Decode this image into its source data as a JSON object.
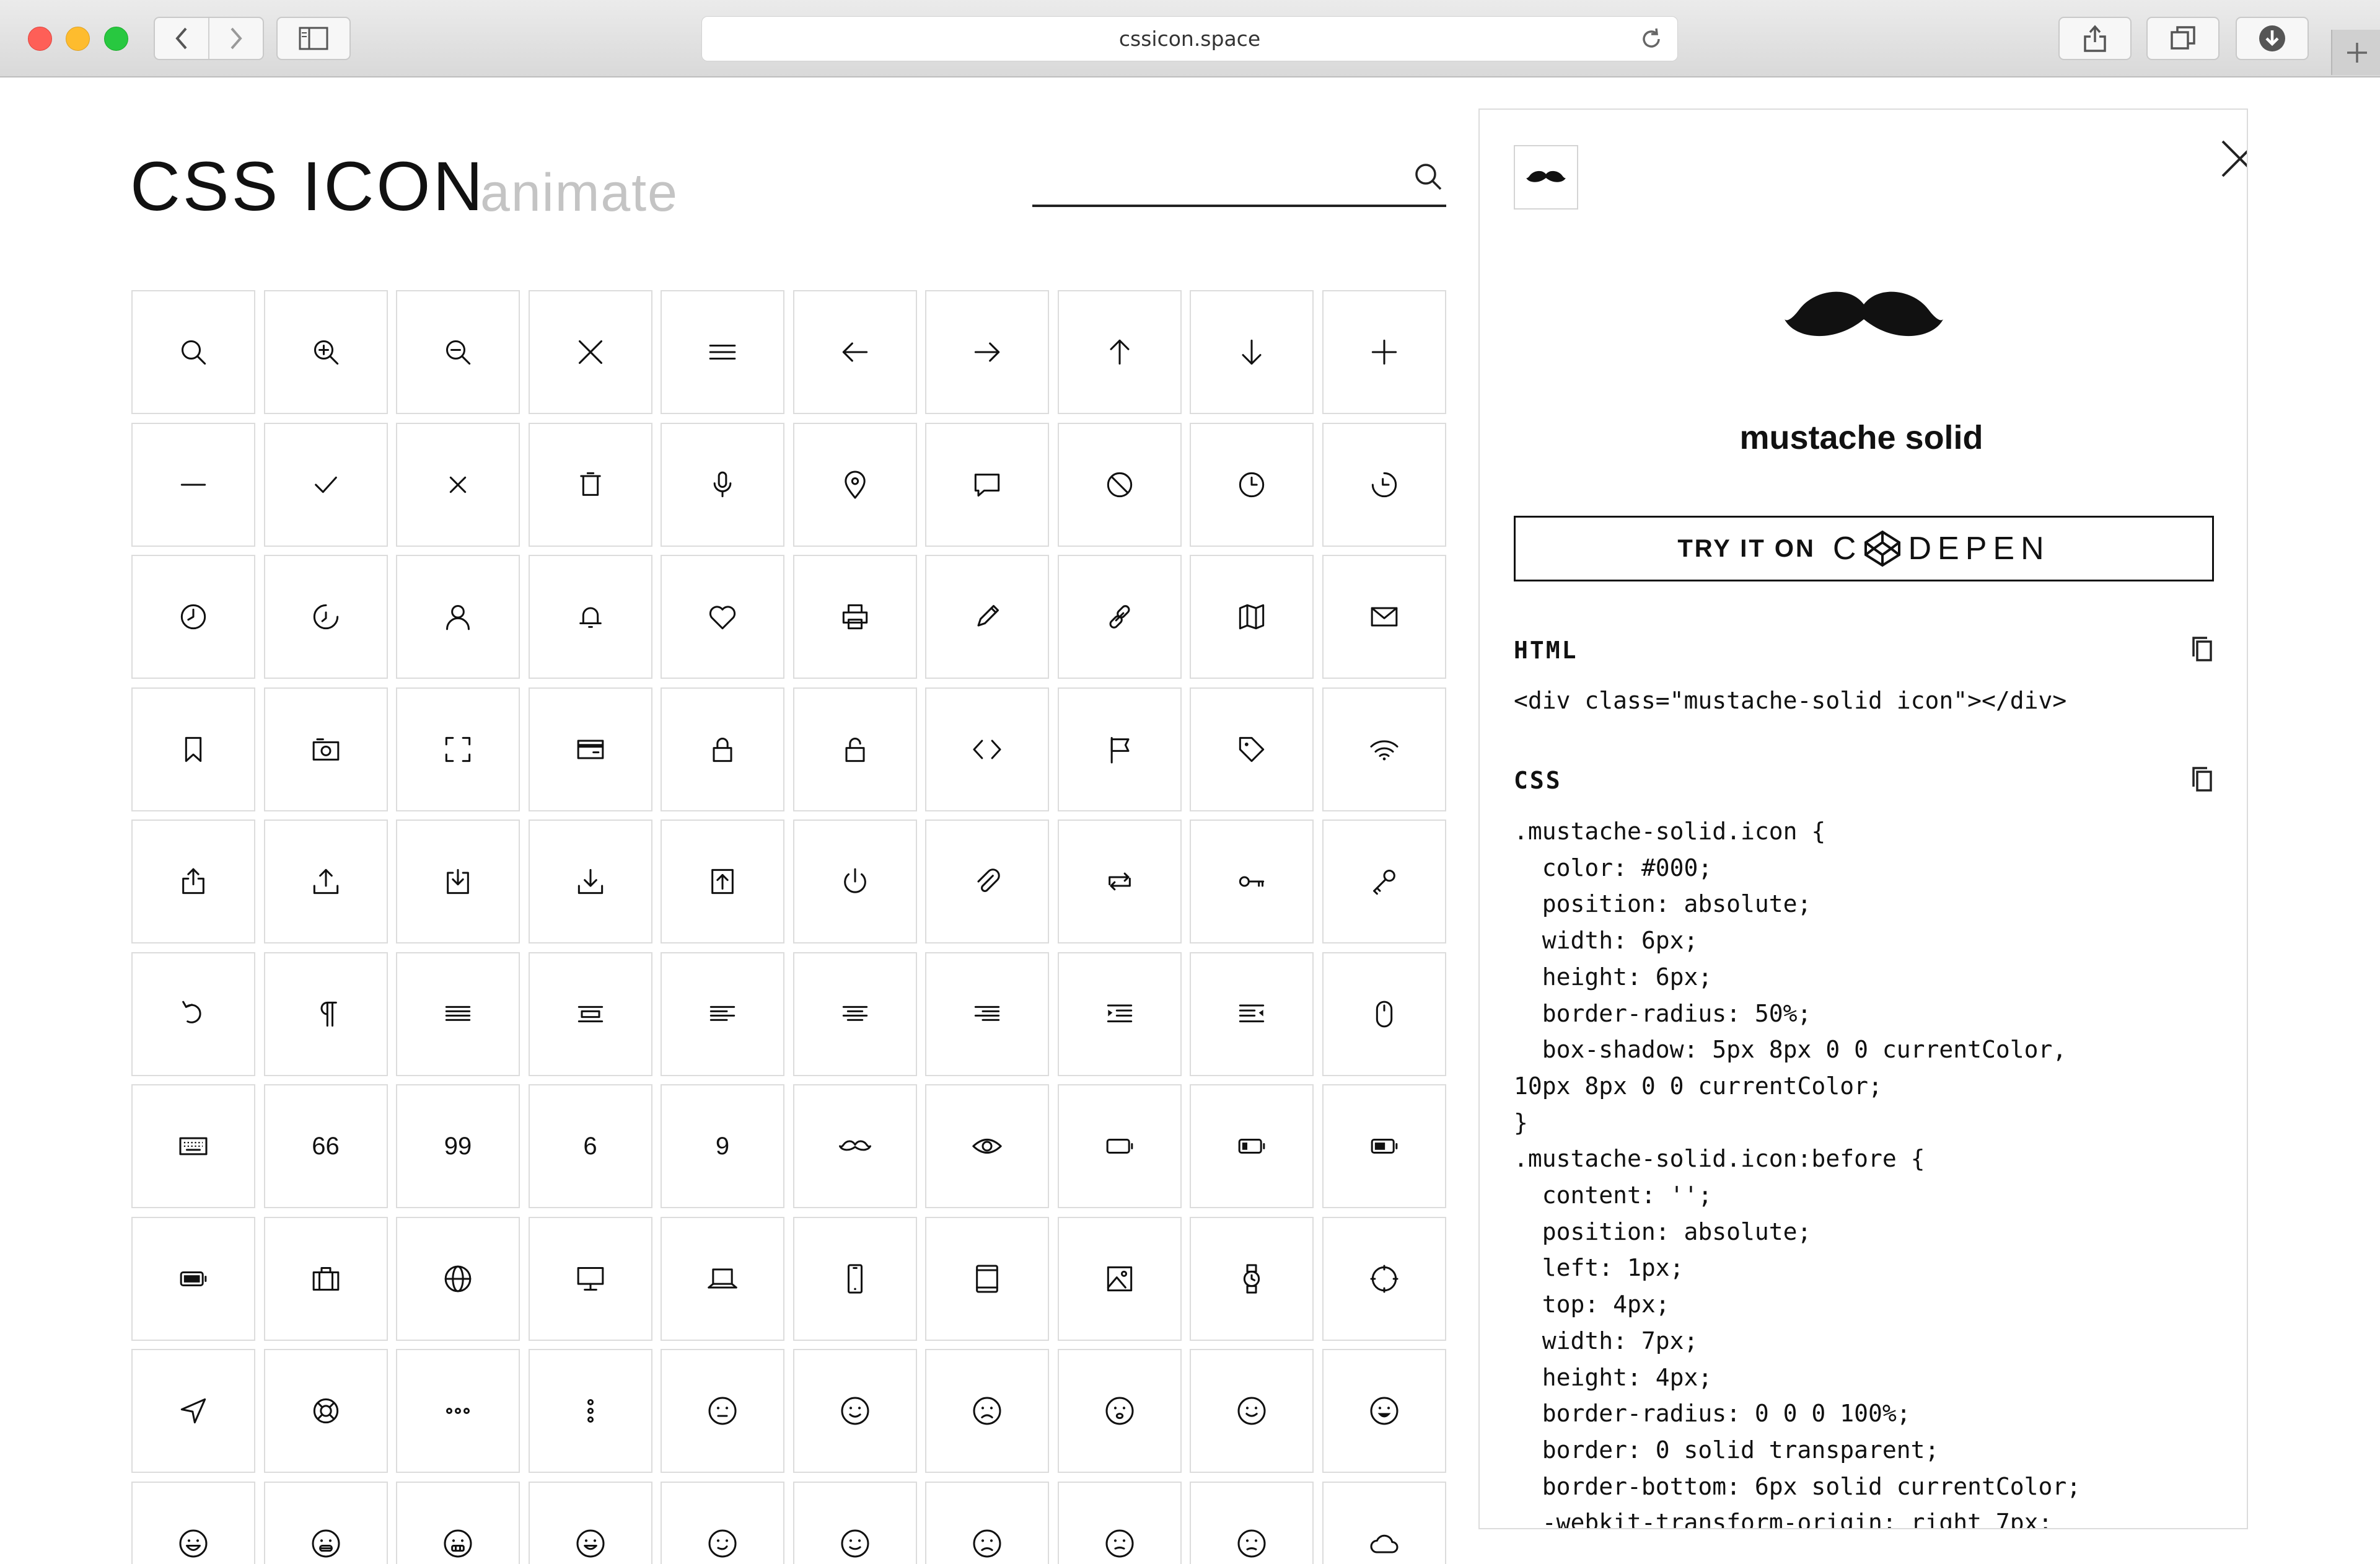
{
  "browser": {
    "url": "cssicon.space"
  },
  "header": {
    "brand": "CSS ICON",
    "brand_sub": "animate",
    "search_placeholder": ""
  },
  "grid": {
    "columns": 10,
    "icons": [
      "search-icon",
      "zoom-in-icon",
      "zoom-out-icon",
      "close-icon",
      "menu-icon",
      "arrow-left-icon",
      "arrow-right-icon",
      "arrow-up-icon",
      "arrow-down-icon",
      "plus-icon",
      "minus-icon",
      "check-icon",
      "cross-icon",
      "trash-icon",
      "microphone-icon",
      "location-pin-icon",
      "chat-bubble-icon",
      "ban-icon",
      "clock-icon",
      "clock-alt-icon",
      "clock-left-icon",
      "clock-right-icon",
      "user-icon",
      "bell-icon",
      "heart-icon",
      "printer-icon",
      "pencil-icon",
      "link-icon",
      "map-icon",
      "mail-icon",
      "bookmark-icon",
      "camera-icon",
      "fullscreen-icon",
      "credit-card-icon",
      "lock-icon",
      "unlock-icon",
      "code-icon",
      "flag-icon",
      "tag-icon",
      "wifi-icon",
      "share-icon",
      "upload-icon",
      "download-box-icon",
      "download-icon",
      "upload-box-icon",
      "power-icon",
      "paperclip-icon",
      "repeat-icon",
      "key-icon",
      "key-alt-icon",
      "undo-icon",
      "paragraph-icon",
      "justify-icon",
      "align-middle-icon",
      "align-left-icon",
      "align-center-icon",
      "align-right-icon",
      "indent-icon",
      "outdent-icon",
      "mouse-icon",
      "keyboard-icon",
      "quote-66-icon",
      "quote-99-icon",
      "quote-6-icon",
      "quote-9-icon",
      "mustache-icon",
      "eye-icon",
      "battery-empty-icon",
      "battery-low-icon",
      "battery-half-icon",
      "battery-full-icon",
      "briefcase-icon",
      "globe-icon",
      "desktop-icon",
      "laptop-icon",
      "smartphone-icon",
      "tablet-icon",
      "image-icon",
      "watch-icon",
      "compass-icon",
      "navigation-icon",
      "lifebuoy-icon",
      "more-horizontal-icon",
      "more-vertical-icon",
      "face-neutral-icon",
      "face-wink-icon",
      "face-sad-icon",
      "face-worried-icon",
      "face-smile-icon",
      "face-grin-icon",
      "face-laugh-icon",
      "face-teeth-icon",
      "face-grimace-icon",
      "face-happy-icon",
      "face-smirk-icon",
      "face-content-icon",
      "face-frown-icon",
      "face-sleepy-icon",
      "face-tired-icon",
      "cloud-icon"
    ],
    "text_cells": {
      "quote-66-icon": "66",
      "quote-99-icon": "99",
      "quote-6-icon": "6",
      "quote-9-icon": "9"
    }
  },
  "panel": {
    "icon_name": "mustache solid",
    "thumb_icon": "mustache-solid-icon",
    "codepen_prefix": "TRY IT ON",
    "codepen_brand_pre": "C",
    "codepen_brand_post": "DEPEN",
    "html_heading": "HTML",
    "html_code": "<div class=\"mustache-solid icon\"></div>",
    "css_heading": "CSS",
    "css_code": ".mustache-solid.icon {\n  color: #000;\n  position: absolute;\n  width: 6px;\n  height: 6px;\n  border-radius: 50%;\n  box-shadow: 5px 8px 0 0 currentColor,\n10px 8px 0 0 currentColor;\n}\n.mustache-solid.icon:before {\n  content: '';\n  position: absolute;\n  left: 1px;\n  top: 4px;\n  width: 7px;\n  height: 4px;\n  border-radius: 0 0 0 100%;\n  border: 0 solid transparent;\n  border-bottom: 6px solid currentColor;\n  -webkit-transform-origin: right 7px;"
  }
}
